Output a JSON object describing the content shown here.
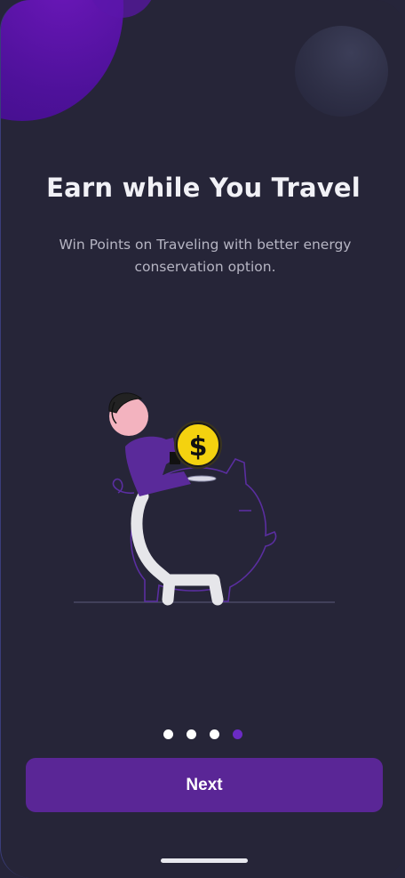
{
  "onboarding": {
    "title": "Earn while You Travel",
    "subtitle": "Win Points on Traveling with better energy conservation option.",
    "illustration": {
      "icon": "piggy-bank-coin-illustration",
      "coin_symbol": "$"
    },
    "pagination": {
      "total": 4,
      "active_index": 3
    },
    "next_label": "Next"
  },
  "colors": {
    "background": "#262538",
    "accent": "#5a2696",
    "active_dot": "#6b2bc4",
    "coin": "#f4d20f"
  }
}
